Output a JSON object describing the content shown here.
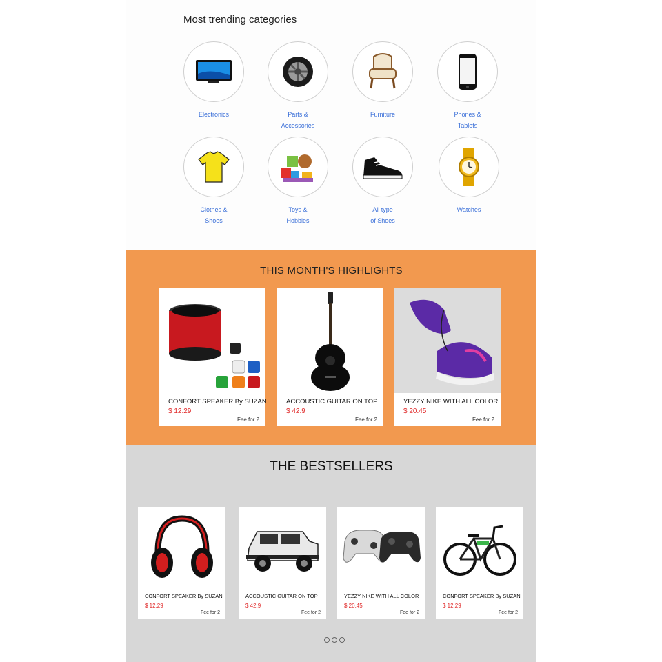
{
  "categories": {
    "title": "Most trending categories",
    "items": [
      {
        "label": "Electronics",
        "icon": "tv-icon"
      },
      {
        "label": "Parts &\nAccessories",
        "icon": "tire-icon"
      },
      {
        "label": "Furniture",
        "icon": "armchair-icon"
      },
      {
        "label": "Phones &\nTablets",
        "icon": "phone-icon"
      },
      {
        "label": "Clothes &\nShoes",
        "icon": "tshirt-icon"
      },
      {
        "label": "Toys &\nHobbies",
        "icon": "toys-icon"
      },
      {
        "label": "All type\nof Shoes",
        "icon": "sneaker-icon"
      },
      {
        "label": "Watches",
        "icon": "watch-icon"
      }
    ]
  },
  "highlights": {
    "title": "THIS MONTH'S HIGHLIGHTS",
    "items": [
      {
        "name": "CONFORT SPEAKER By SUZAN",
        "price": "$ 12.29",
        "fee": "Fee for 2",
        "image": "speaker-image"
      },
      {
        "name": "ACCOUSTIC GUITAR ON TOP",
        "price": "$ 42.9",
        "fee": "Fee for 2",
        "image": "guitar-image"
      },
      {
        "name": "YEZZY NIKE WITH ALL COLOR",
        "price": "$ 20.45",
        "fee": "Fee for 2",
        "image": "sneaker-image"
      }
    ]
  },
  "bestsellers": {
    "title": "THE BESTSELLERS",
    "items": [
      {
        "name": "CONFORT SPEAKER By SUZAN",
        "price": "$ 12.29",
        "fee": "Fee for 2",
        "image": "headphones-image"
      },
      {
        "name": "ACCOUSTIC GUITAR ON TOP",
        "price": "$ 42.9",
        "fee": "Fee for 2",
        "image": "jeep-image"
      },
      {
        "name": "YEZZY NIKE WITH ALL COLOR",
        "price": "$ 20.45",
        "fee": "Fee for 2",
        "image": "gamepad-image"
      },
      {
        "name": "CONFORT SPEAKER By SUZAN",
        "price": "$ 12.29",
        "fee": "Fee for 2",
        "image": "bicycle-image"
      }
    ],
    "pagination": {
      "pages": 3
    }
  },
  "colors": {
    "highlight_bg": "#f2994f",
    "bestseller_bg": "#d7d7d7",
    "price": "#e02828",
    "category_label": "#3a6fd8"
  }
}
